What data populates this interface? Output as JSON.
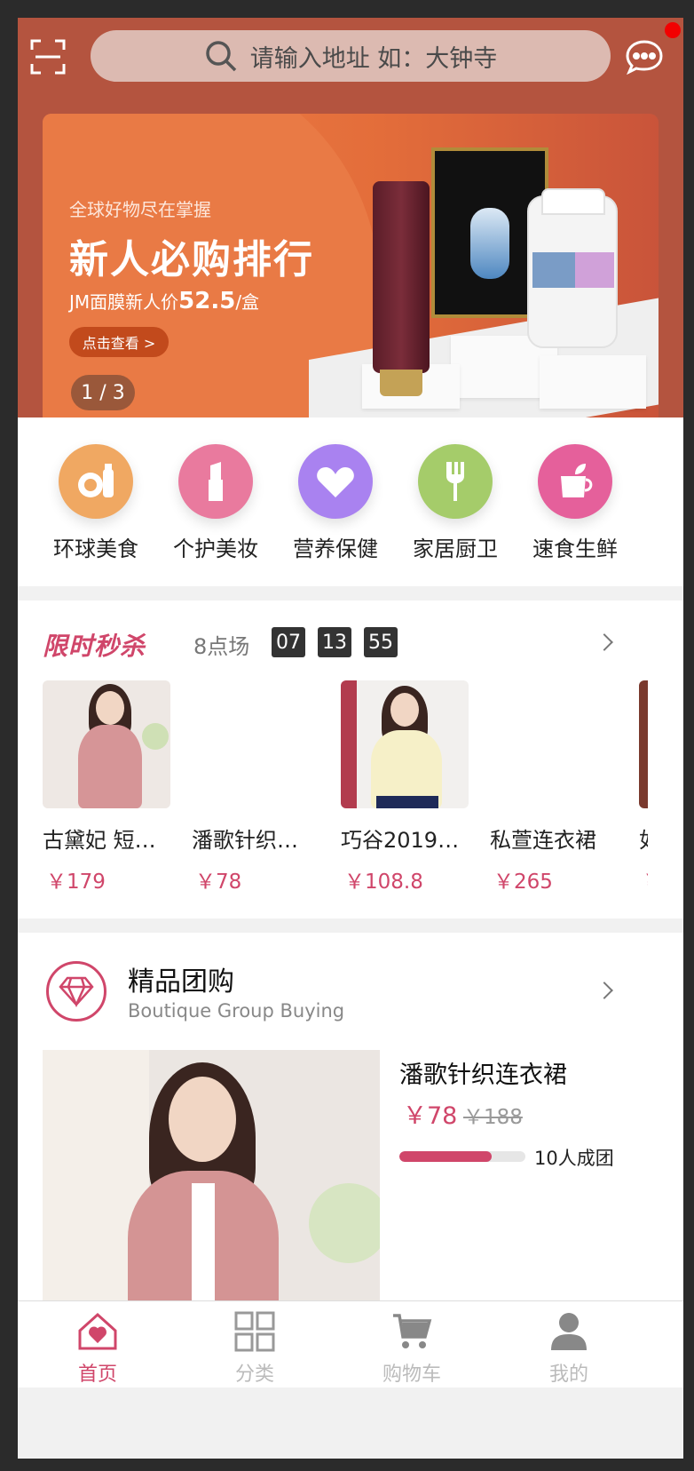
{
  "header": {
    "search_placeholder": "请输入地址 如：大钟寺",
    "icons": {
      "scan": "scan-icon",
      "search": "search-icon",
      "message": "message-icon"
    }
  },
  "banner": {
    "subtitle": "全球好物尽在掌握",
    "title": "新人必购排行",
    "promo_prefix": "JM面膜新人价",
    "promo_price": "52.5",
    "promo_suffix": "/盒",
    "cta": "点击查看 >",
    "pager": "1 / 3"
  },
  "categories": [
    {
      "label": "环球美食",
      "icon": "food-icon",
      "color": "#f0a862"
    },
    {
      "label": "个护美妆",
      "icon": "lipstick-icon",
      "color": "#e97a9e"
    },
    {
      "label": "营养保健",
      "icon": "heart-icon",
      "color": "#a982f0"
    },
    {
      "label": "家居厨卫",
      "icon": "fork-icon",
      "color": "#a5cc6a"
    },
    {
      "label": "速食生鲜",
      "icon": "cup-icon",
      "color": "#e5609b"
    }
  ],
  "flash_sale": {
    "title": "限时秒杀",
    "slot": "8点场",
    "hours": "07",
    "minutes": "13",
    "seconds": "55",
    "items": [
      {
        "name": "古黛妃 短…",
        "price": "￥179"
      },
      {
        "name": "潘歌针织…",
        "price": "￥78"
      },
      {
        "name": "巧谷2019…",
        "price": "￥108.8"
      },
      {
        "name": "私萱连衣裙",
        "price": "￥265"
      },
      {
        "name": "如",
        "price": "￥"
      }
    ]
  },
  "group_buy": {
    "title": "精品团购",
    "subtitle": "Boutique Group Buying",
    "product_name": "潘歌针织连衣裙",
    "price": "￥78",
    "original_price": "￥188",
    "progress": 0.73,
    "people": "10人成团"
  },
  "tabbar": {
    "tabs": [
      {
        "label": "首页",
        "icon": "home-icon",
        "active": true
      },
      {
        "label": "分类",
        "icon": "category-icon",
        "active": false
      },
      {
        "label": "购物车",
        "icon": "cart-icon",
        "active": false
      },
      {
        "label": "我的",
        "icon": "user-icon",
        "active": false
      }
    ]
  },
  "colors": {
    "accent": "#d0466a",
    "header_bg": "#b4543f"
  }
}
